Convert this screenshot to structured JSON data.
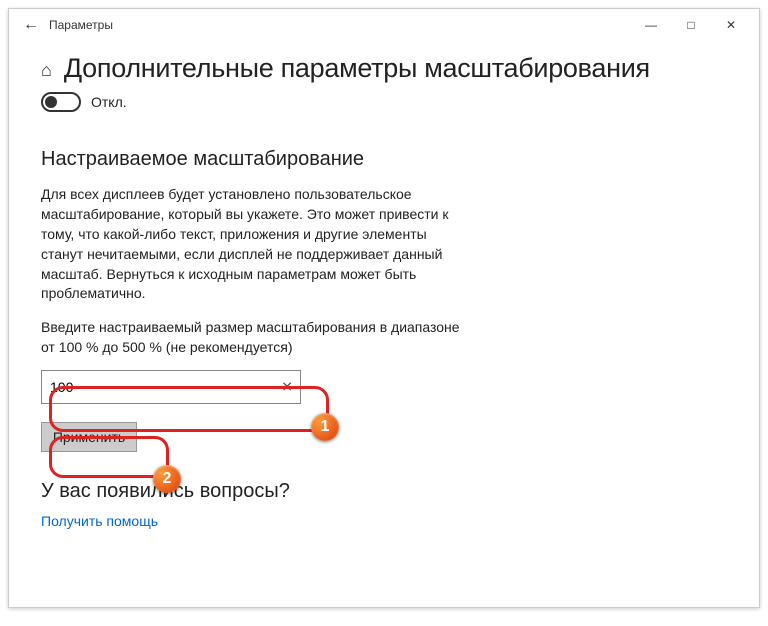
{
  "titlebar": {
    "app_name": "Параметры"
  },
  "page": {
    "title": "Дополнительные параметры масштабирования",
    "toggle_label": "Откл."
  },
  "custom_scaling": {
    "heading": "Настраиваемое масштабирование",
    "description": "Для всех дисплеев будет установлено пользовательское масштабирование, который вы укажете. Это может привести к тому, что какой-либо текст, приложения и другие элементы станут нечитаемыми, если дисплей не поддерживает данный масштаб. Вернуться к исходным параметрам может быть проблематично.",
    "input_label": "Введите настраиваемый размер масштабирования в диапазоне от 100 % до 500 % (не рекомендуется)",
    "input_value": "100",
    "apply_label": "Применить"
  },
  "faq": {
    "heading": "У вас появились вопросы?",
    "link_label": "Получить помощь"
  },
  "callouts": {
    "n1": "1",
    "n2": "2"
  }
}
